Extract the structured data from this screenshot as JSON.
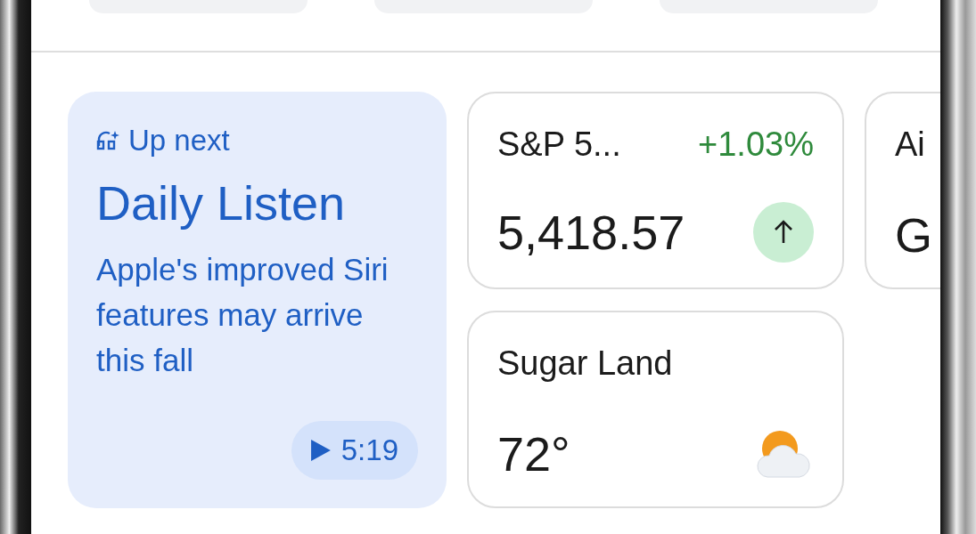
{
  "up_next": {
    "label": "Up next",
    "title": "Daily Listen",
    "summary": "Apple's improved Siri features may arrive this fall",
    "duration": "5:19"
  },
  "stock": {
    "name": "S&P 5...",
    "change": "+1.03%",
    "value": "5,418.57",
    "rising": true
  },
  "weather": {
    "place": "Sugar Land",
    "temperature": "72°"
  },
  "partial_card": {
    "line_1": "Ai",
    "line_2": "G"
  }
}
